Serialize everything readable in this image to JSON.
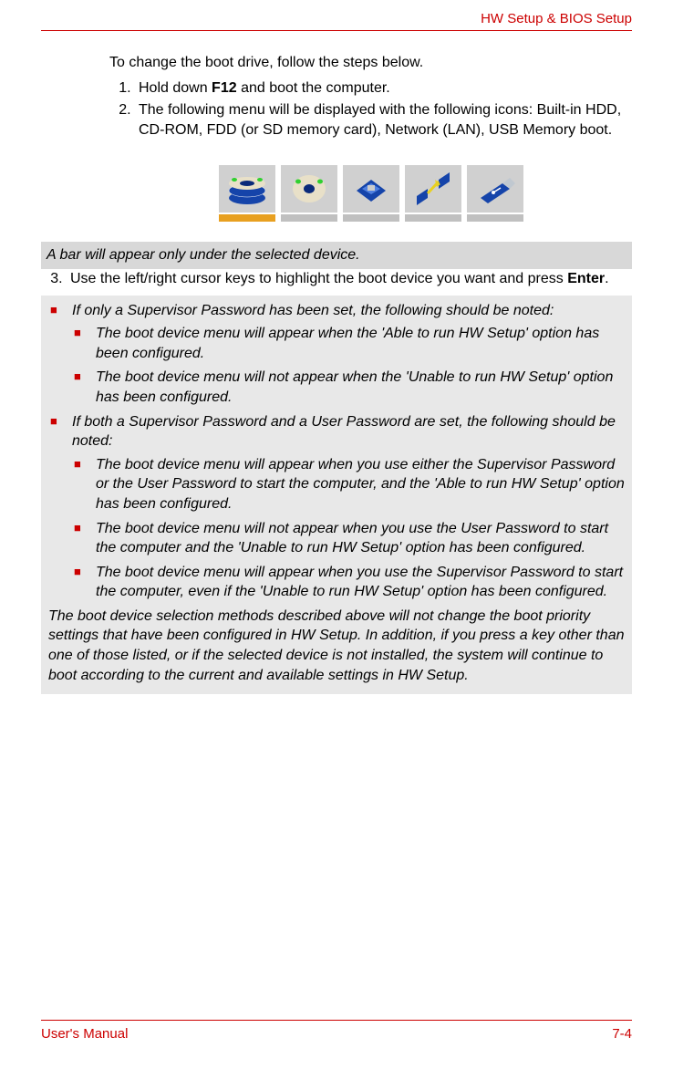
{
  "header": {
    "section": "HW Setup & BIOS Setup"
  },
  "content": {
    "intro": "To change the boot drive, follow the steps below.",
    "step1_pre": "Hold down ",
    "step1_key": "F12",
    "step1_post": " and boot the computer.",
    "step2": "The following menu will be displayed with the following icons: Built-in HDD, CD-ROM, FDD (or SD memory card), Network (LAN), USB Memory boot.",
    "step3_pre": "Use the left/right cursor keys to highlight the boot device you want and press ",
    "step3_key": "Enter",
    "step3_post": "."
  },
  "icons": {
    "hdd": "hdd-icon",
    "cdrom": "cdrom-icon",
    "fdd": "fdd-icon",
    "network": "network-icon",
    "usb": "usb-icon"
  },
  "note1": "A bar will appear only under the selected device.",
  "note2": {
    "b1": "If only a Supervisor Password has been set, the following should be noted:",
    "b1s1": "The boot device menu will appear when the 'Able to run HW Setup' option has been configured.",
    "b1s2": "The boot device menu will not appear when the 'Unable to run HW Setup' option has been configured.",
    "b2": "If both a Supervisor Password and a User Password are set, the following should be noted:",
    "b2s1": "The boot device menu will appear when you use either the Supervisor Password or the User Password to start the computer, and the 'Able to run HW Setup' option has been configured.",
    "b2s2": "The boot device menu will not appear when you use the User Password to start the computer and the 'Unable to run HW Setup' option has been configured.",
    "b2s3": "The boot device menu will appear when you use the Supervisor Password to start the computer, even if the 'Unable to run HW Setup' option has been configured.",
    "para": "The boot device selection methods described above will not change the boot priority settings that have been configured in HW Setup. In addition, if you press a key other than one of those listed, or if the selected device is not installed, the system will continue to boot according to the current and available settings in HW Setup."
  },
  "footer": {
    "left": "User's Manual",
    "right": "7-4"
  }
}
